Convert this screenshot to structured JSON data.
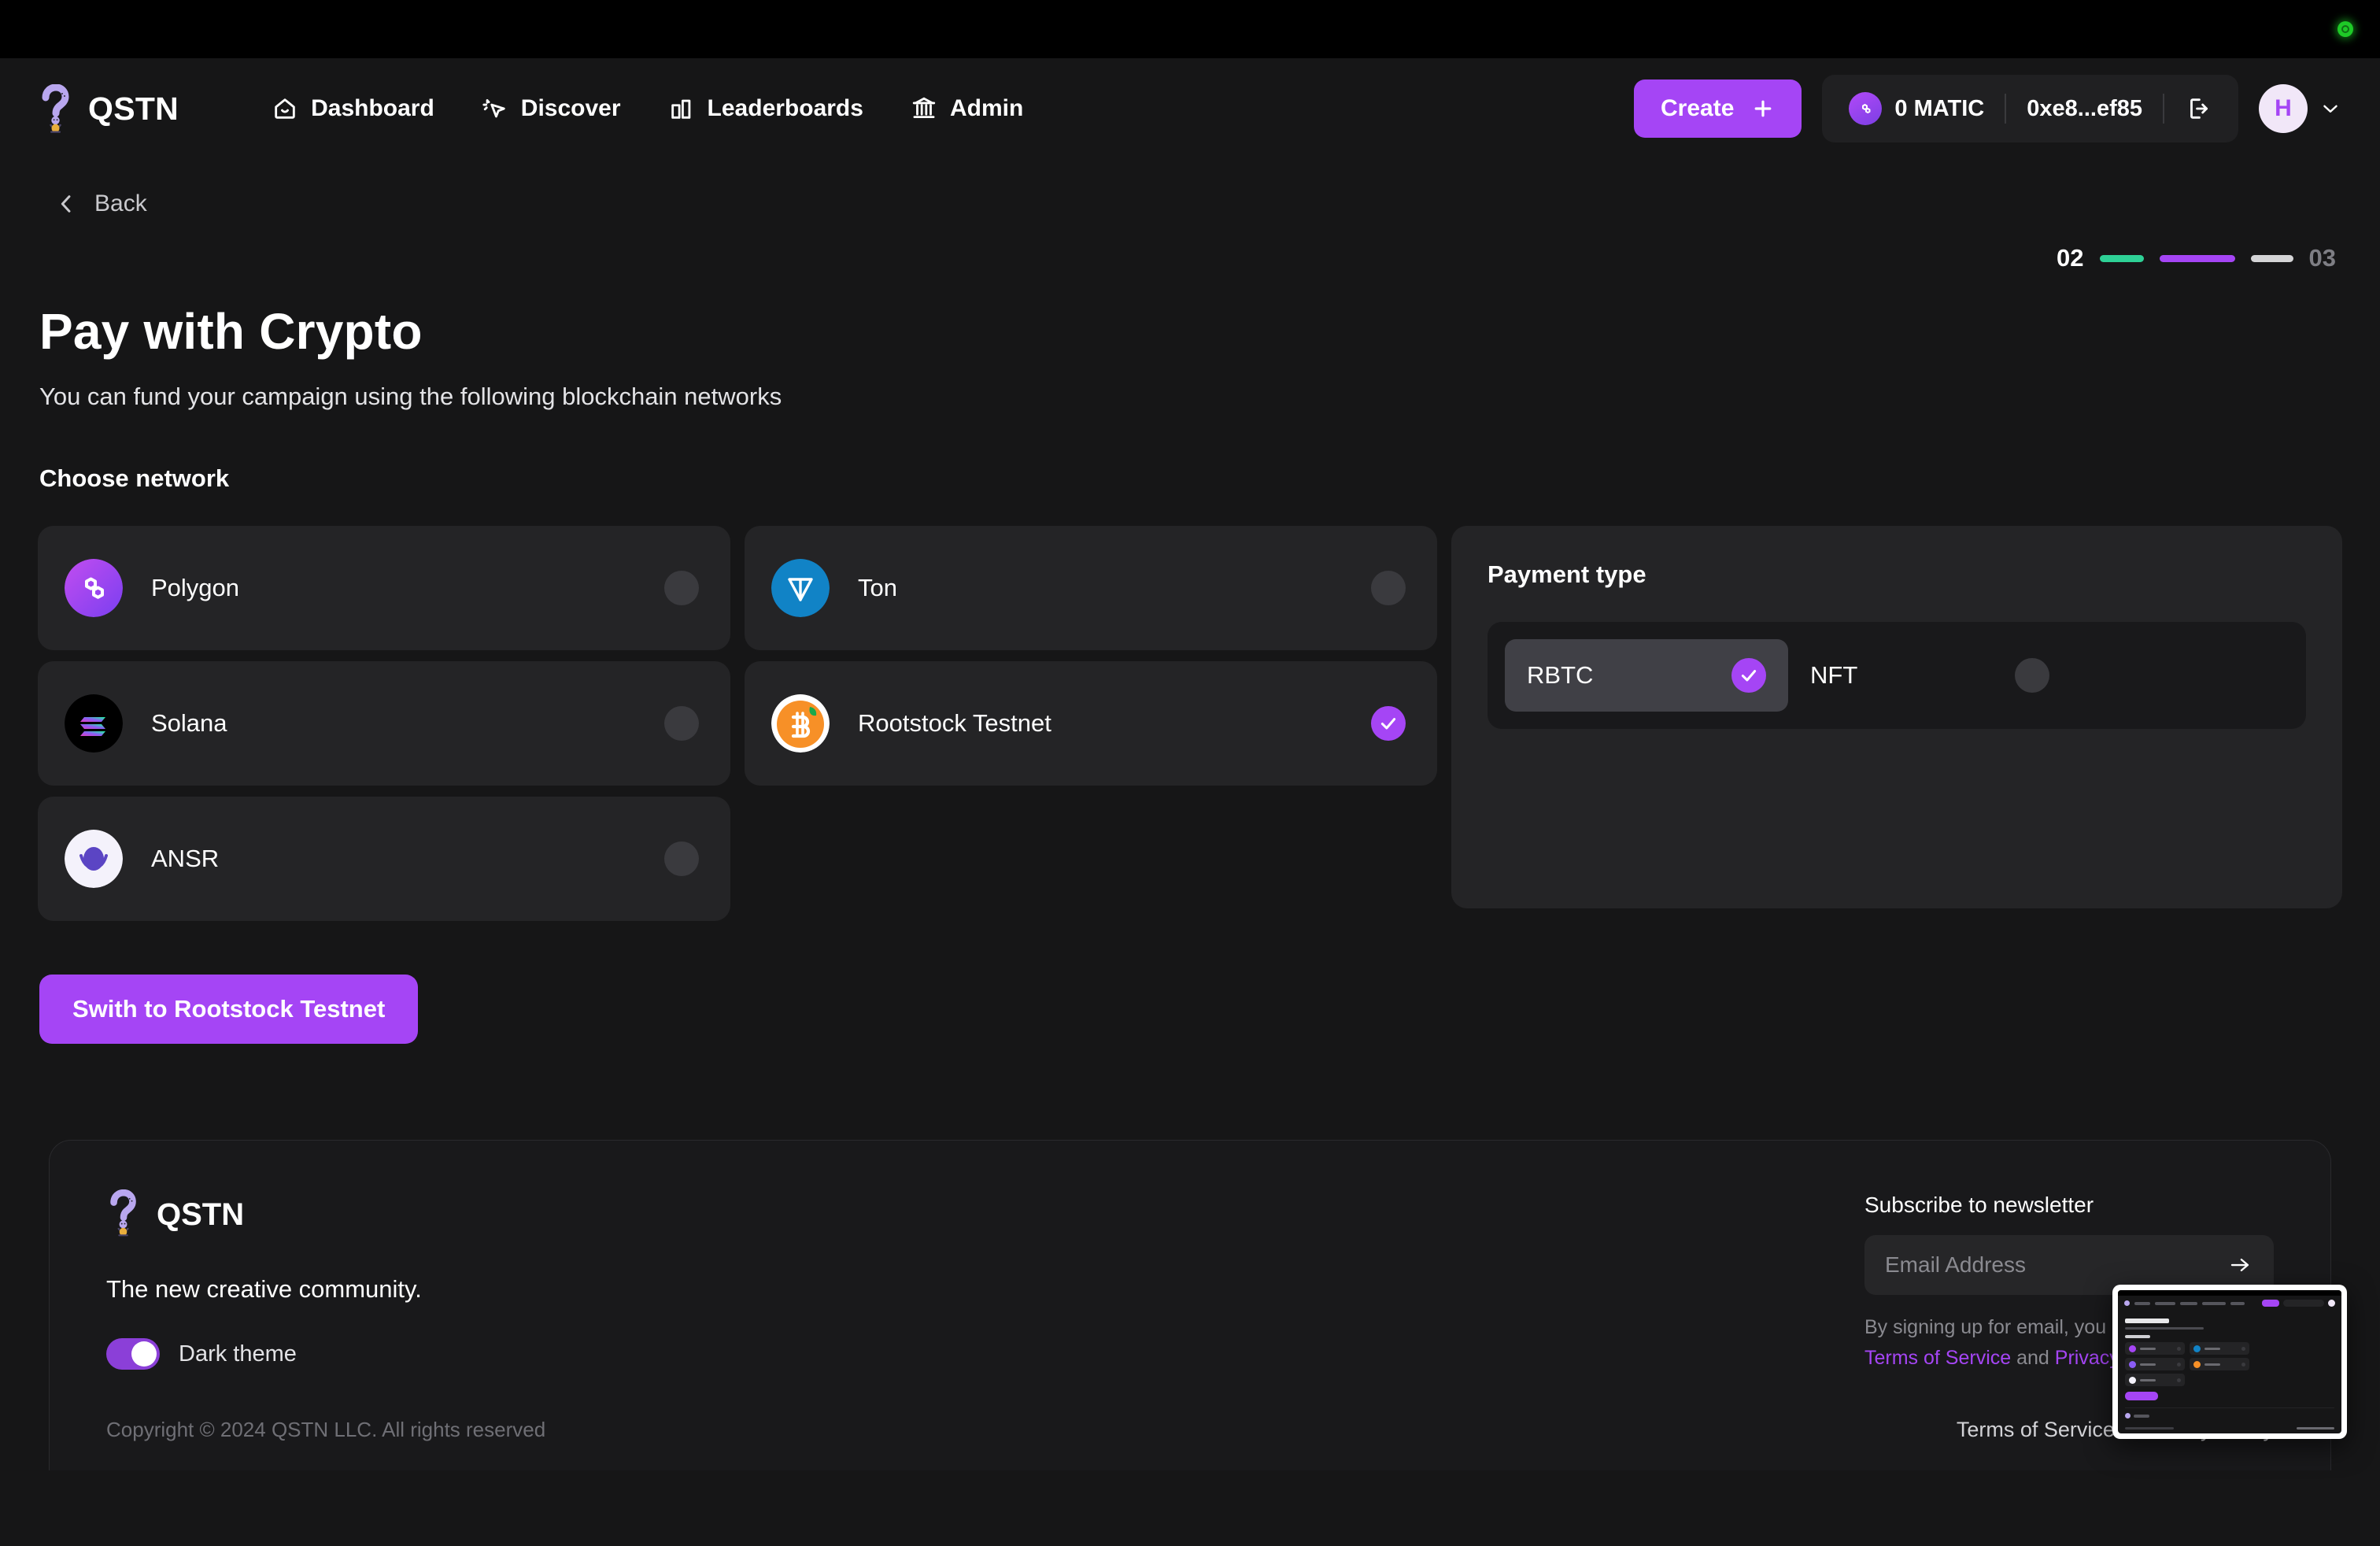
{
  "os_bar": {
    "recording_indicator": "recording-dot"
  },
  "header": {
    "brand": "QSTN",
    "nav": [
      {
        "label": "Dashboard",
        "icon": "home-icon"
      },
      {
        "label": "Discover",
        "icon": "cursor-sparkle-icon"
      },
      {
        "label": "Leaderboards",
        "icon": "bar-chart-icon"
      },
      {
        "label": "Admin",
        "icon": "bank-icon"
      }
    ],
    "create_label": "Create",
    "balance": "0 MATIC",
    "address": "0xe8...ef85",
    "logout_icon": "logout-icon",
    "avatar_initial": "H",
    "chevron": "chevron-down-icon"
  },
  "back": {
    "label": "Back",
    "icon": "chevron-left-icon"
  },
  "steps": {
    "current": "02",
    "next": "03"
  },
  "main": {
    "title": "Pay with Crypto",
    "subtitle": "You can fund your campaign using the following blockchain networks",
    "choose_network_label": "Choose network",
    "networks_left": [
      {
        "name": "Polygon",
        "selected": false,
        "icon": "polygon-icon"
      },
      {
        "name": "Solana",
        "selected": false,
        "icon": "solana-icon"
      },
      {
        "name": "ANSR",
        "selected": false,
        "icon": "ansr-icon"
      }
    ],
    "networks_right": [
      {
        "name": "Ton",
        "selected": false,
        "icon": "ton-icon"
      },
      {
        "name": "Rootstock Testnet",
        "selected": true,
        "icon": "rootstock-icon"
      }
    ],
    "payment": {
      "title": "Payment type",
      "options": [
        {
          "label": "RBTC",
          "selected": true
        },
        {
          "label": "NFT",
          "selected": false
        }
      ]
    },
    "switch_button": "Swith to Rootstock Testnet"
  },
  "footer": {
    "brand": "QSTN",
    "tagline": "The new creative community.",
    "theme_toggle_label": "Dark theme",
    "theme_toggle_on": true,
    "newsletter": {
      "title": "Subscribe to newsletter",
      "placeholder": "Email Address",
      "value": "",
      "submit_icon": "arrow-right-icon",
      "note_prefix": "By signing up for email, you agree to our ",
      "note_terms": "Terms of Service",
      "note_and": " and ",
      "note_privacy": "Privacy Policy"
    },
    "copyright": "Copyright © 2024 QSTN LLC. All rights reserved",
    "links": [
      "Terms of Service",
      "Privacy Policy"
    ]
  },
  "colors": {
    "accent_purple": "#a545f5",
    "step_green": "#2ed196",
    "page_bg": "#161617",
    "card_bg": "#242426",
    "recording_green": "#1ec927"
  }
}
